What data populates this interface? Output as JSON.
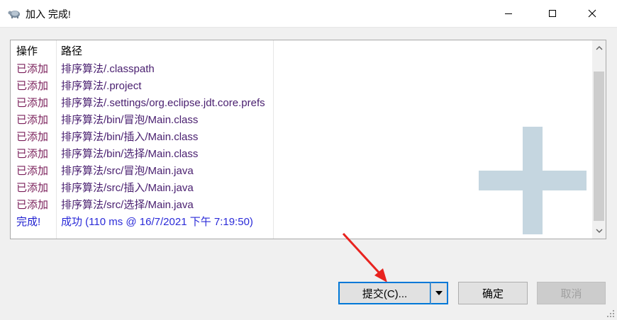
{
  "window": {
    "title": "加入 完成!",
    "app_icon": "tortoise-svn-icon",
    "controls": [
      "minimize-icon",
      "maximize-icon",
      "close-icon"
    ]
  },
  "list": {
    "columns": [
      "操作",
      "路径"
    ],
    "rows": [
      {
        "action": "已添加",
        "path": "排序算法/.classpath",
        "kind": "added"
      },
      {
        "action": "已添加",
        "path": "排序算法/.project",
        "kind": "added"
      },
      {
        "action": "已添加",
        "path": "排序算法/.settings/org.eclipse.jdt.core.prefs",
        "kind": "added"
      },
      {
        "action": "已添加",
        "path": "排序算法/bin/冒泡/Main.class",
        "kind": "added"
      },
      {
        "action": "已添加",
        "path": "排序算法/bin/插入/Main.class",
        "kind": "added"
      },
      {
        "action": "已添加",
        "path": "排序算法/bin/选择/Main.class",
        "kind": "added"
      },
      {
        "action": "已添加",
        "path": "排序算法/src/冒泡/Main.java",
        "kind": "added"
      },
      {
        "action": "已添加",
        "path": "排序算法/src/插入/Main.java",
        "kind": "added"
      },
      {
        "action": "已添加",
        "path": "排序算法/src/选择/Main.java",
        "kind": "added"
      },
      {
        "action": "完成!",
        "path": "成功 (110 ms @ 16/7/2021 下午 7:19:50)",
        "kind": "done"
      }
    ]
  },
  "buttons": {
    "commit": "提交(C)...",
    "ok": "确定",
    "cancel": "取消"
  },
  "colors": {
    "added_text": "#7a1f5a",
    "done_text": "#2020d0",
    "accent": "#0078d7",
    "watermark": "#c5d6e0",
    "annotation_arrow": "#e8231f"
  }
}
